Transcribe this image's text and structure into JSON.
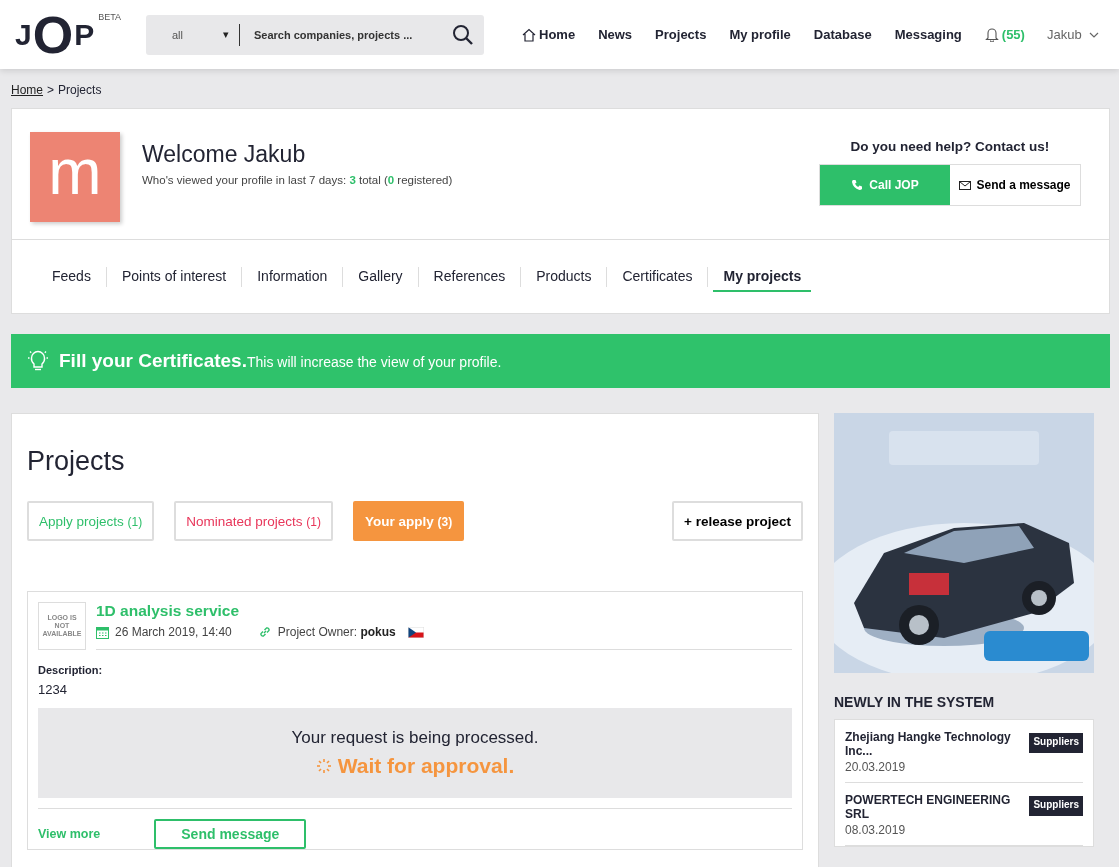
{
  "header": {
    "logo": "JOP",
    "logo_badge": "BETA",
    "search": {
      "scope": "all",
      "scope_arrow": "▾",
      "placeholder": "Search companies, projects ..."
    },
    "nav": [
      {
        "label": "Home",
        "kind": "home"
      },
      {
        "label": "News",
        "kind": "link"
      },
      {
        "label": "Projects",
        "kind": "link"
      },
      {
        "label": "My profile",
        "kind": "link"
      },
      {
        "label": "Database",
        "kind": "link"
      },
      {
        "label": "Messaging",
        "kind": "link"
      },
      {
        "label": "(55)",
        "kind": "bell"
      },
      {
        "label": "Jakub",
        "kind": "user"
      }
    ]
  },
  "breadcrumb": [
    {
      "label": "Home",
      "link": true
    },
    {
      "label": ">",
      "link": false
    },
    {
      "label": "Projects",
      "link": false
    }
  ],
  "profile": {
    "avatar_letter": "m",
    "welcome": "Welcome Jakub",
    "views_prefix": "Who's viewed your profile in last 7 days:",
    "views_total": "3",
    "views_total_label": "total (",
    "views_registered": "0",
    "views_registered_label": "registered)",
    "help_title": "Do you need help? Contact us!",
    "call_button": "Call JOP",
    "message_button": "Send a message",
    "tabs": [
      {
        "label": "Feeds",
        "selected": false
      },
      {
        "label": "Points of interest",
        "selected": false
      },
      {
        "label": "Information",
        "selected": false
      },
      {
        "label": "Gallery",
        "selected": false
      },
      {
        "label": "References",
        "selected": false
      },
      {
        "label": "Products",
        "selected": false
      },
      {
        "label": "Certificates",
        "selected": false
      },
      {
        "label": "My projects",
        "selected": true
      }
    ]
  },
  "banner": {
    "title": "Fill your Certificates.",
    "text": "This will increase the view of your profile."
  },
  "projects": {
    "title": "Projects",
    "filters": [
      {
        "label": "Apply projects",
        "count": "(1)",
        "color": "#2ebf6a",
        "selected": false
      },
      {
        "label": "Nominated projects",
        "count": "(1)",
        "color": "#e8365a",
        "selected": false
      },
      {
        "label": "Your apply",
        "count": "(3)",
        "color": "#f5953f",
        "selected": true
      }
    ],
    "release_button": "+ release project",
    "items": [
      {
        "logo_text": "LOGO IS NOT AVAILABLE",
        "name": "1D analysis service",
        "date": "26 March 2019, 14:40",
        "owner_label": "Project Owner:",
        "owner": "pokus",
        "description_label": "Description:",
        "description": "1234",
        "status_title": "Your request is being processed.",
        "status_text": "Wait for approval.",
        "view_more": "View more",
        "send_message": "Send message"
      }
    ]
  },
  "sidebar": {
    "newly_title": "NEWLY IN THE SYSTEM",
    "companies": [
      {
        "name": "Zhejiang Hangke Technology Inc...",
        "date": "20.03.2019",
        "tag": "Suppliers"
      },
      {
        "name": "POWERTECH ENGINEERING SRL",
        "date": "08.03.2019",
        "tag": "Suppliers"
      }
    ]
  }
}
